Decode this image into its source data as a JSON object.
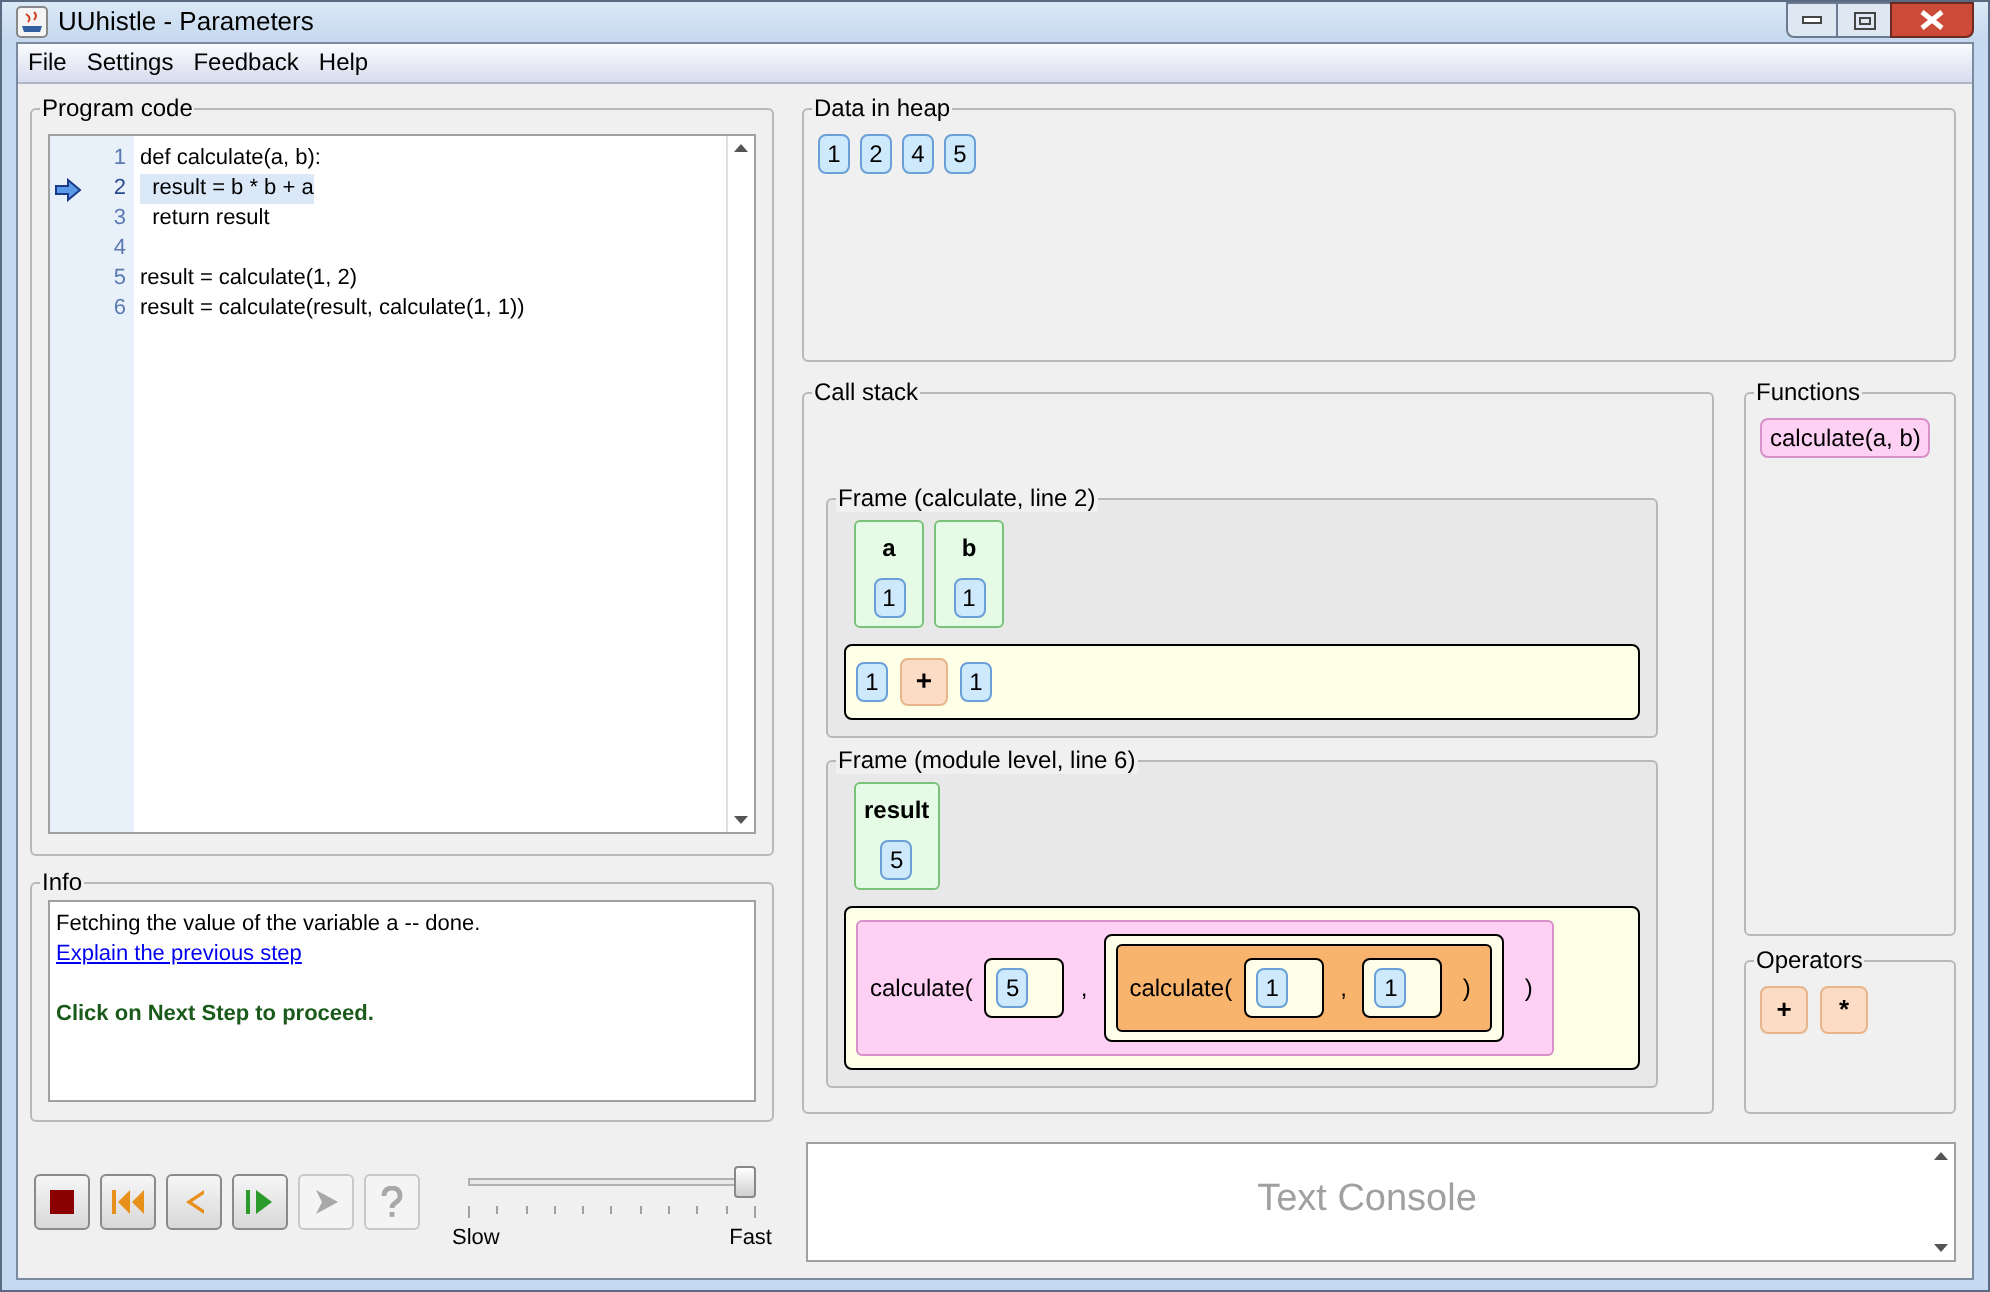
{
  "window": {
    "title": "UUhistle - Parameters"
  },
  "menu": [
    "File",
    "Settings",
    "Feedback",
    "Help"
  ],
  "program_code": {
    "title": "Program code",
    "lines": [
      {
        "number": "1",
        "text": "def calculate(a, b):",
        "current": false
      },
      {
        "number": "2",
        "text": "  result = b * b + a",
        "current": true
      },
      {
        "number": "3",
        "text": "  return result",
        "current": false
      },
      {
        "number": "4",
        "current": false
      },
      {
        "number": "5",
        "text": "result = calculate(1, 2)",
        "current": false
      },
      {
        "number": "6",
        "text": "result = calculate(result, calculate(1, 1))",
        "current": false
      }
    ]
  },
  "info": {
    "title": "Info",
    "message": "Fetching the value of the variable a -- done.",
    "link": "Explain the previous step",
    "prompt": "Click on Next Step to proceed."
  },
  "controls": [
    {
      "kind": "stop",
      "disabled": false
    },
    {
      "kind": "rewind",
      "disabled": false
    },
    {
      "kind": "back",
      "disabled": false
    },
    {
      "kind": "step",
      "disabled": false
    },
    {
      "kind": "forward",
      "disabled": true
    },
    {
      "kind": "help",
      "disabled": true
    }
  ],
  "speed": {
    "level": 1,
    "min_label": "Slow",
    "max_label": "Fast"
  },
  "heap": {
    "title": "Data in heap",
    "values": [
      "1",
      "2",
      "4",
      "5"
    ]
  },
  "call_stack": {
    "title": "Call stack",
    "frames": [
      {
        "title": "Frame (calculate, line 2)",
        "variables": [
          {
            "name": "a",
            "value": "1"
          },
          {
            "name": "b",
            "value": "1"
          }
        ],
        "expression": [
          {
            "kind": "value",
            "text": "1"
          },
          {
            "kind": "operator",
            "text": "+"
          },
          {
            "kind": "value",
            "text": "1"
          }
        ]
      },
      {
        "title": "Frame (module level, line 6)",
        "variables": [
          {
            "name": "result",
            "value": "5"
          }
        ],
        "expression": [
          {
            "kind": "call",
            "name": "calculate(",
            "active": false,
            "args": [
              [
                {
                  "kind": "value",
                  "text": "5"
                }
              ],
              [
                {
                  "kind": "call",
                  "name": "calculate(",
                  "active": true,
                  "args": [
                    [
                      {
                        "kind": "value",
                        "text": "1"
                      }
                    ],
                    [
                      {
                        "kind": "value",
                        "text": "1"
                      }
                    ]
                  ],
                  "separator": ",",
                  "close": ")"
                }
              ]
            ],
            "separator": ",",
            "close": ")"
          }
        ]
      }
    ]
  },
  "functions": {
    "title": "Functions",
    "items": [
      "calculate(a, b)"
    ]
  },
  "operators": {
    "title": "Operators",
    "items": [
      "+",
      "*"
    ]
  },
  "console": {
    "placeholder": "Text Console"
  }
}
